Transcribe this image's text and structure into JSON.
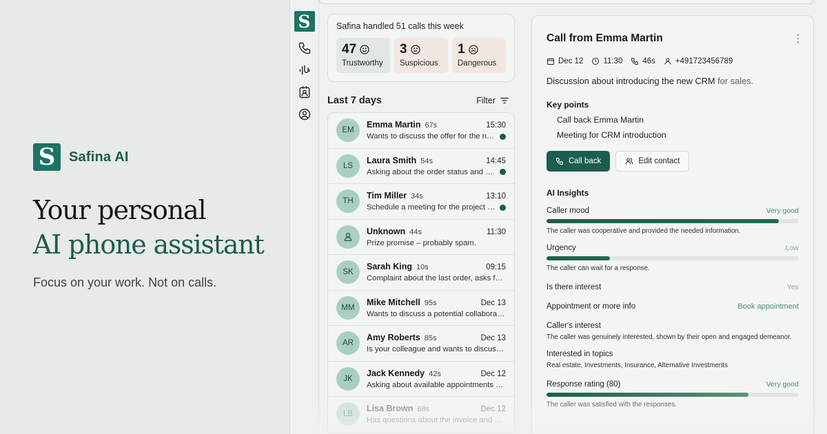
{
  "hero": {
    "brand_name": "Safina AI",
    "logo_letter": "S",
    "title_line1": "Your personal",
    "title_line2": "AI phone assistant",
    "subtitle": "Focus on your work. Not on calls."
  },
  "rail": {
    "logo_letter": "S",
    "icons": [
      "phone-icon",
      "waveform-icon",
      "contacts-icon",
      "account-icon"
    ]
  },
  "stats": {
    "title": "Safina handled 51 calls this week",
    "items": [
      {
        "value": "47",
        "label": "Trustworthy",
        "icon": "smile-icon"
      },
      {
        "value": "3",
        "label": "Suspicious",
        "icon": "neutral-face-icon"
      },
      {
        "value": "1",
        "label": "Dangerous",
        "icon": "frown-icon"
      }
    ]
  },
  "list": {
    "title": "Last 7 days",
    "filter_label": "Filter",
    "rows": [
      {
        "initials": "EM",
        "name": "Emma Martin",
        "duration": "67s",
        "time": "15:30",
        "message": "Wants to discuss the offer for the new CRM",
        "unread": true
      },
      {
        "initials": "LS",
        "name": "Laura Smith",
        "duration": "54s",
        "time": "14:45",
        "message": "Asking about the order status and delivery",
        "unread": true
      },
      {
        "initials": "TH",
        "name": "Tim Miller",
        "duration": "34s",
        "time": "13:10",
        "message": "Schedule a meeting for the project kickoff",
        "unread": true
      },
      {
        "initials": "",
        "name": "Unknown",
        "duration": "44s",
        "time": "11:30",
        "message": "Prize promise – probably spam.",
        "unread": false
      },
      {
        "initials": "SK",
        "name": "Sarah King",
        "duration": "10s",
        "time": "09:15",
        "message": "Complaint about the last order, asks for a refund",
        "unread": false
      },
      {
        "initials": "MM",
        "name": "Mike Mitchell",
        "duration": "95s",
        "time": "Dec 13",
        "message": "Wants to discuss a potential collaboration",
        "unread": false
      },
      {
        "initials": "AR",
        "name": "Amy Roberts",
        "duration": "85s",
        "time": "Dec 13",
        "message": "Is your colleague and wants to discuss the report",
        "unread": false
      },
      {
        "initials": "JK",
        "name": "Jack Kennedy",
        "duration": "42s",
        "time": "Dec 12",
        "message": "Asking about available appointments next week",
        "unread": false
      },
      {
        "initials": "LB",
        "name": "Lisa Brown",
        "duration": "68s",
        "time": "Dec 12",
        "message": "Has questions about the invoice and a discount",
        "unread": false
      }
    ]
  },
  "detail": {
    "title": "Call from Emma Martin",
    "date": "Dec 12",
    "time": "11:30",
    "duration": "46s",
    "phone": "+491723456789",
    "desc_main": "Discussion about introducing the new CRM",
    "desc_muted": "for sales.",
    "key_points_title": "Key points",
    "key_points": [
      "Call back Emma Martin",
      "Meeting for CRM introduction"
    ],
    "call_back_label": "Call back",
    "edit_contact_label": "Edit contact",
    "ai_title": "AI Insights",
    "mood": {
      "label": "Caller mood",
      "value": "Very good",
      "level": 0.92,
      "note": "The caller was cooperative and provided the needed information."
    },
    "urgency": {
      "label": "Urgency",
      "value": "Low",
      "level": 0.25,
      "note": "The caller can wait for a response."
    },
    "interest": {
      "label": "Is there interest",
      "value": "Yes"
    },
    "appointment": {
      "label": "Appointment or more info",
      "value": "Book appointment"
    },
    "caller_interest": {
      "label": "Caller's interest",
      "text": "The caller was genuinely interested, shown by their open and engaged demeanor."
    },
    "topics": {
      "label": "Interested in topics",
      "text": "Real estate, Investments, Insurance, Alternative Investments"
    },
    "rating": {
      "label": "Response rating (80)",
      "value": "Very good",
      "level": 0.8,
      "note": "The caller was satisfied with the responses."
    }
  }
}
